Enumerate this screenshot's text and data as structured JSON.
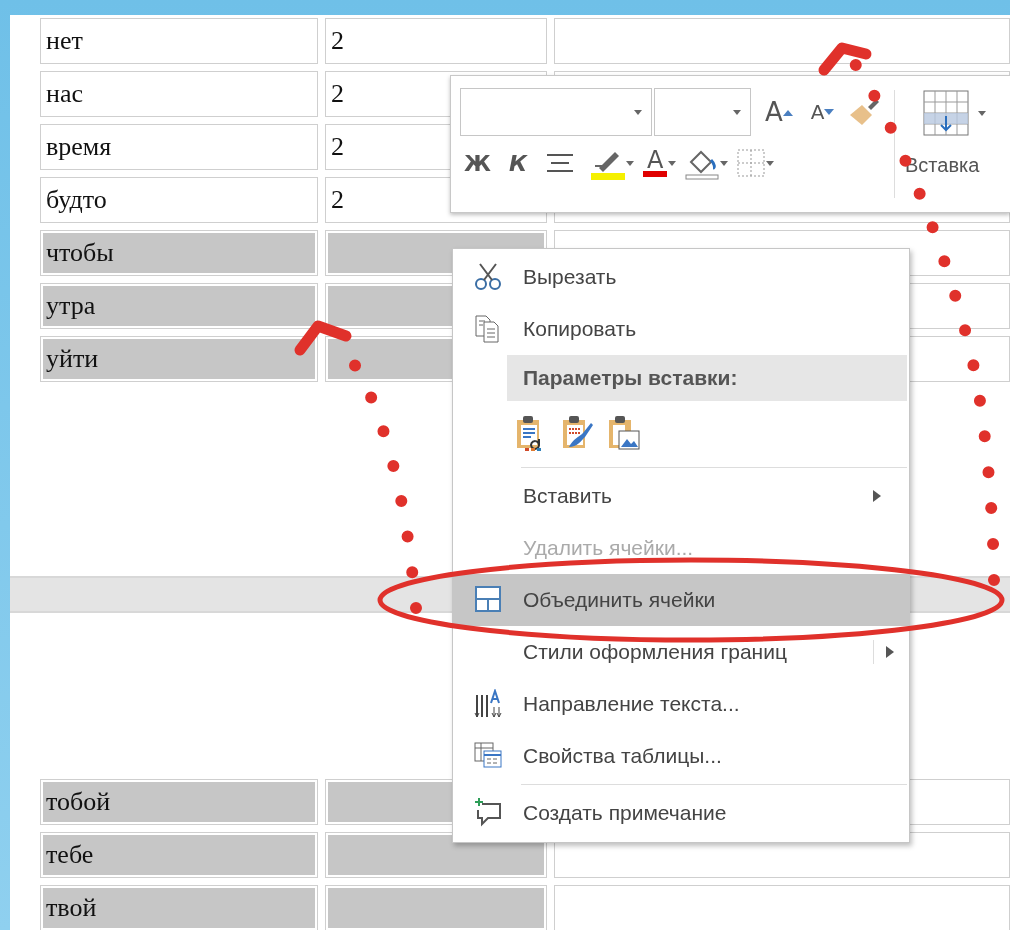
{
  "table_top": {
    "rows": [
      {
        "word": "нет",
        "count": "2",
        "selected": false
      },
      {
        "word": "нас",
        "count": "2",
        "selected": false
      },
      {
        "word": "время",
        "count": "2",
        "selected": false
      },
      {
        "word": "будто",
        "count": "2",
        "selected": false
      },
      {
        "word": "чтобы",
        "selected": true
      },
      {
        "word": "утра",
        "selected": true
      },
      {
        "word": "уйти",
        "selected": true
      }
    ]
  },
  "table_bottom": {
    "rows": [
      {
        "word": "тобой",
        "selected": true
      },
      {
        "word": "тебе",
        "selected": true
      },
      {
        "word": "твой",
        "selected": true
      }
    ]
  },
  "mini_toolbar": {
    "grow_font": "A",
    "shrink_font": "A",
    "bold": "Ж",
    "italic": "К",
    "font_color": "A",
    "insert": "Вставка"
  },
  "context_menu": {
    "items": [
      {
        "kind": "command",
        "label": "Вырезать",
        "selected": false,
        "disabled": false
      },
      {
        "kind": "command",
        "label": "Копировать",
        "selected": false,
        "disabled": false
      },
      {
        "kind": "header",
        "label": "Параметры вставки:"
      },
      {
        "kind": "paste_options"
      },
      {
        "kind": "command",
        "label": "Вставить",
        "submenu": true,
        "divider_before": true,
        "selected": false,
        "disabled": false
      },
      {
        "kind": "command",
        "label": "Удалить ячейки...",
        "selected": false,
        "disabled": true
      },
      {
        "kind": "command",
        "label": "Объединить ячейки",
        "selected": true,
        "disabled": false
      },
      {
        "kind": "command",
        "label": "Стили оформления границ",
        "submenu": true,
        "split": true,
        "selected": false,
        "disabled": false
      },
      {
        "kind": "command",
        "label": "Направление текста...",
        "selected": false,
        "disabled": false
      },
      {
        "kind": "command",
        "label": "Свойства таблицы...",
        "selected": false,
        "disabled": false
      },
      {
        "kind": "command",
        "label": "Создать примечание",
        "divider_before": true,
        "selected": false,
        "disabled": false
      }
    ]
  },
  "annotations": [
    {
      "kind": "dotted_arrow"
    },
    {
      "kind": "dotted_arrow"
    },
    {
      "kind": "ellipse"
    }
  ]
}
